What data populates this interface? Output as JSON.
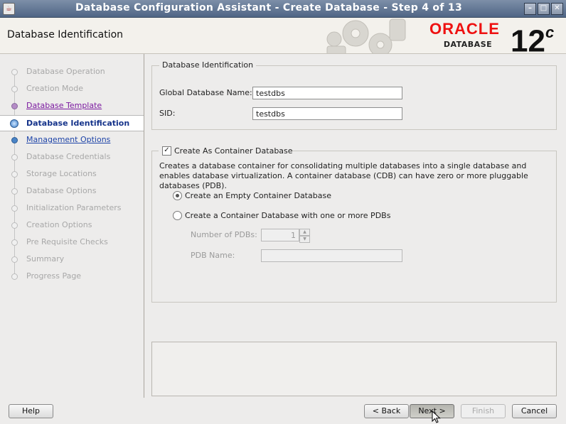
{
  "window": {
    "title": "Database Configuration Assistant - Create Database - Step 4 of 13",
    "app_icon": "java-cup-icon",
    "controls": [
      "minimize-icon",
      "maximize-icon",
      "close-icon"
    ]
  },
  "header": {
    "page_title": "Database Identification",
    "brand": "ORACLE",
    "brand_sub": "DATABASE",
    "version": "12",
    "version_sup": "c"
  },
  "steps": [
    {
      "label": "Database Operation",
      "state": "disabled"
    },
    {
      "label": "Creation Mode",
      "state": "disabled"
    },
    {
      "label": "Database Template",
      "state": "done"
    },
    {
      "label": "Database Identification",
      "state": "current"
    },
    {
      "label": "Management Options",
      "state": "next"
    },
    {
      "label": "Database Credentials",
      "state": "disabled"
    },
    {
      "label": "Storage Locations",
      "state": "disabled"
    },
    {
      "label": "Database Options",
      "state": "disabled"
    },
    {
      "label": "Initialization Parameters",
      "state": "disabled"
    },
    {
      "label": "Creation Options",
      "state": "disabled"
    },
    {
      "label": "Pre Requisite Checks",
      "state": "disabled"
    },
    {
      "label": "Summary",
      "state": "disabled"
    },
    {
      "label": "Progress Page",
      "state": "disabled"
    }
  ],
  "identification": {
    "legend": "Database Identification",
    "global_name_label": "Global Database Name:",
    "global_name_value": "testdbs",
    "sid_label": "SID:",
    "sid_value": "testdbs"
  },
  "container": {
    "checkbox_label": "Create As Container Database",
    "checked": true,
    "description": "Creates a database container for consolidating multiple databases into a single database and enables database virtualization. A container database (CDB) can have zero or more pluggable databases (PDB).",
    "option_empty": "Create an Empty Container Database",
    "option_pdbs": "Create a Container Database with one or more PDBs",
    "selected": "empty",
    "num_pdbs_label": "Number of PDBs:",
    "num_pdbs_value": "1",
    "pdb_name_label": "PDB Name:",
    "pdb_name_value": ""
  },
  "buttons": {
    "help": "Help",
    "back": "< Back",
    "next": "Next >",
    "finish": "Finish",
    "cancel": "Cancel"
  }
}
